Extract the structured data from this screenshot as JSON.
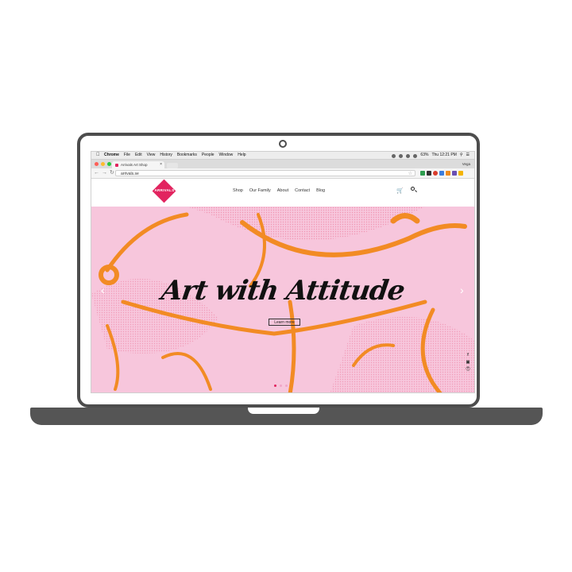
{
  "menubar": {
    "apple_icon": "apple-icon",
    "menus": [
      "Chrome",
      "File",
      "Edit",
      "View",
      "History",
      "Bookmarks",
      "People",
      "Window",
      "Help"
    ],
    "battery": "63%",
    "clock": "Thu 12:21 PM"
  },
  "browser": {
    "tab_title": "Arrivals Art Shop",
    "user": "Vega",
    "url": "arrivals.se"
  },
  "site": {
    "logo_text": "ARRIVALS",
    "nav": [
      "Shop",
      "Our Family",
      "About",
      "Contact",
      "Blog"
    ],
    "hero_title": "Art with Attitude",
    "cta": "Learn more",
    "social": [
      "f",
      "ig",
      "p"
    ],
    "slides": 3,
    "active_slide": 1
  },
  "colors": {
    "brand_pink": "#e2245f",
    "hero_bg": "#f7c6dc",
    "hero_accent": "#f28b24",
    "frame": "#4d4d4d"
  }
}
